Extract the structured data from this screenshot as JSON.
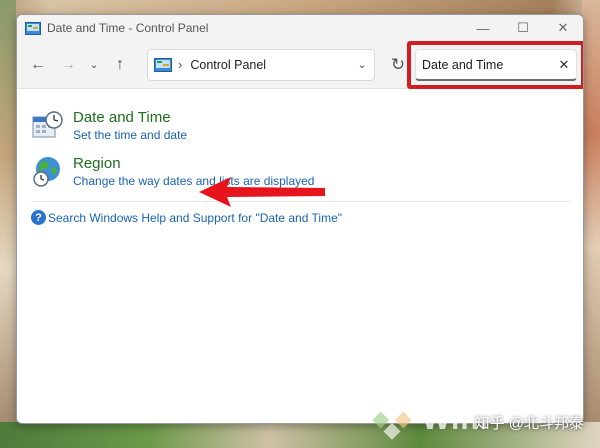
{
  "window": {
    "title": "Date and Time - Control Panel"
  },
  "title_controls": {
    "minimize": "—",
    "maximize": "☐",
    "close": "✕"
  },
  "nav": {
    "back": "←",
    "forward": "→",
    "recent": "⌄",
    "up": "↑",
    "refresh": "↻"
  },
  "address": {
    "separator": "›",
    "path": "Control Panel",
    "dropdown": "⌄"
  },
  "search": {
    "value": "Date and Time",
    "clear": "✕",
    "highlight_color": "#d01e1e"
  },
  "results": [
    {
      "title": "Date and Time",
      "link": "Set the time and date",
      "icon": "date-time-icon"
    },
    {
      "title": "Region",
      "link": "Change the way dates and lists are displayed",
      "icon": "region-globe-icon"
    }
  ],
  "help": {
    "icon_glyph": "?",
    "text": "Search Windows Help and Support for \"Date and Time\""
  },
  "annotation": {
    "arrow_color": "#e8141b"
  },
  "watermark": {
    "text": "WinP",
    "credit": "知乎 @北斗邦泰"
  },
  "colors": {
    "title_green": "#1e6f1e",
    "link_blue": "#1a63b3"
  }
}
